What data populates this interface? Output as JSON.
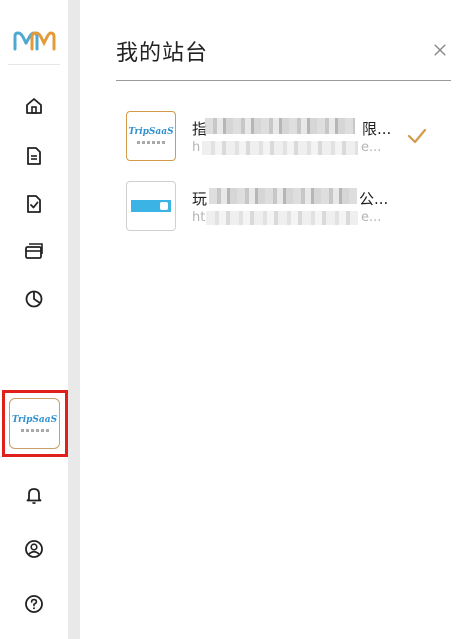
{
  "panel": {
    "title": "我的站台"
  },
  "sites": [
    {
      "name_start": "指",
      "name_end": "限...",
      "url_start": "h",
      "url_end": "e...",
      "thumb": "TripSaaS",
      "selected": true
    },
    {
      "name_start": "玩",
      "name_end": "公...",
      "url_start": "ht",
      "url_end": "e...",
      "thumb": "banner",
      "selected": false
    }
  ],
  "current_site": {
    "thumb": "TripSaaS"
  },
  "rail": {
    "items": [
      {
        "icon": "home-icon"
      },
      {
        "icon": "document-icon"
      },
      {
        "icon": "file-check-icon"
      },
      {
        "icon": "card-stack-icon"
      },
      {
        "icon": "pie-chart-icon"
      }
    ],
    "bottom": [
      {
        "icon": "bell-icon"
      },
      {
        "icon": "user-icon"
      },
      {
        "icon": "help-icon"
      }
    ]
  },
  "colors": {
    "accent": "#d39a4a",
    "highlight": "#e0201b",
    "brand_blue": "#2f8fd0"
  }
}
